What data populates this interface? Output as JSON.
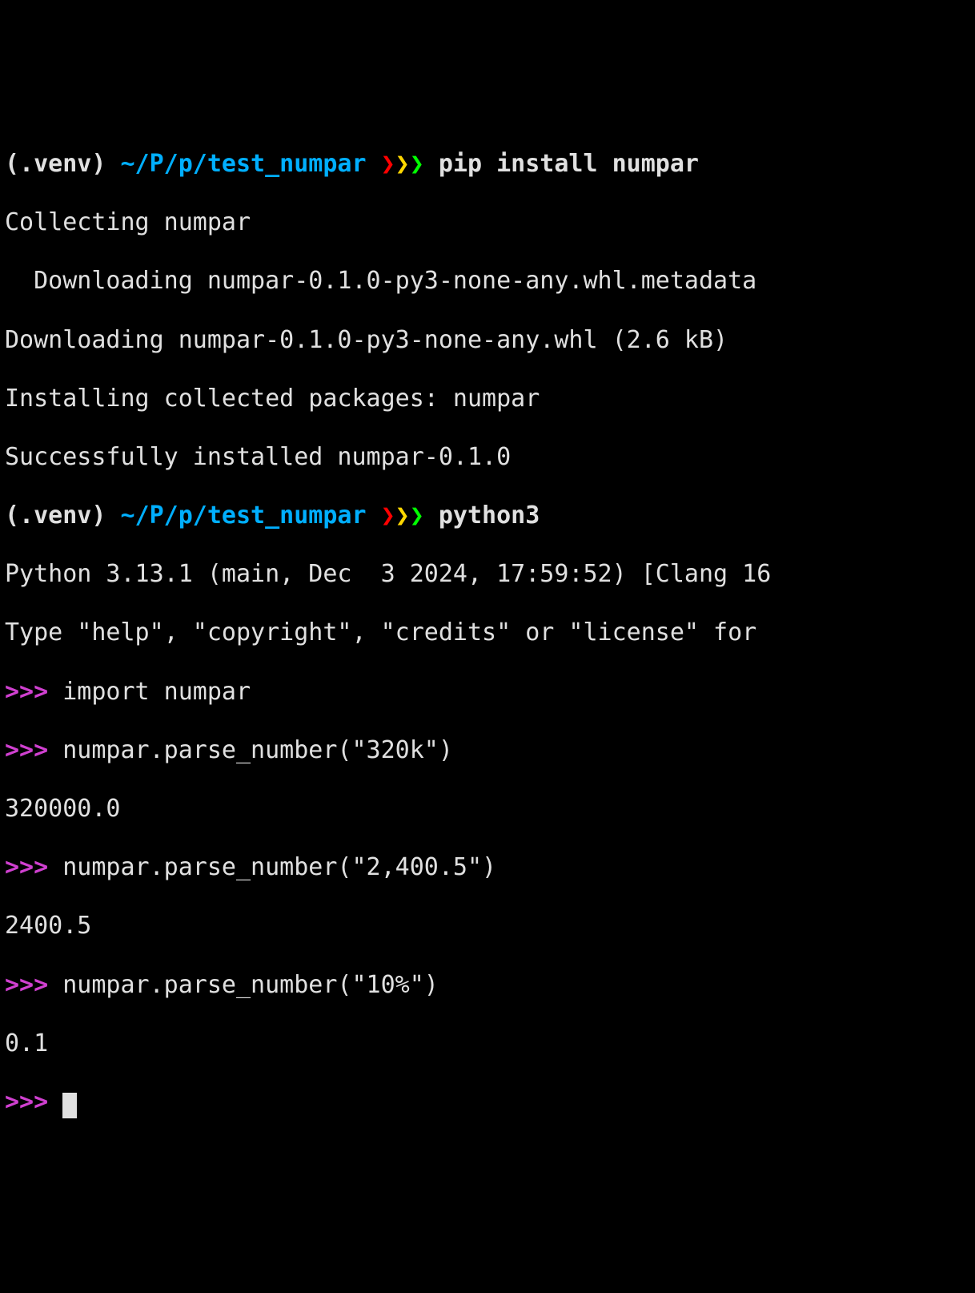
{
  "shell": {
    "venv": "(.venv)",
    "path": "~/P/p/test_numpar",
    "chev1": "❯",
    "chev2": "❯",
    "chev3": "❯"
  },
  "prompts": [
    {
      "command": "pip install numpar"
    },
    {
      "command": "python3"
    }
  ],
  "pip_output": {
    "l1": "Collecting numpar",
    "l2": "  Downloading numpar-0.1.0-py3-none-any.whl.metadata ",
    "l3": "Downloading numpar-0.1.0-py3-none-any.whl (2.6 kB)",
    "l4": "Installing collected packages: numpar",
    "l5": "Successfully installed numpar-0.1.0"
  },
  "python": {
    "banner1": "Python 3.13.1 (main, Dec  3 2024, 17:59:52) [Clang 16",
    "banner2": "Type \"help\", \"copyright\", \"credits\" or \"license\" for ",
    "prompt": ">>>",
    "lines": [
      {
        "in": "import numpar"
      },
      {
        "in": "numpar.parse_number(\"320k\")",
        "out": "320000.0"
      },
      {
        "in": "numpar.parse_number(\"2,400.5\")",
        "out": "2400.5"
      },
      {
        "in": "numpar.parse_number(\"10%\")",
        "out": "0.1"
      }
    ]
  }
}
